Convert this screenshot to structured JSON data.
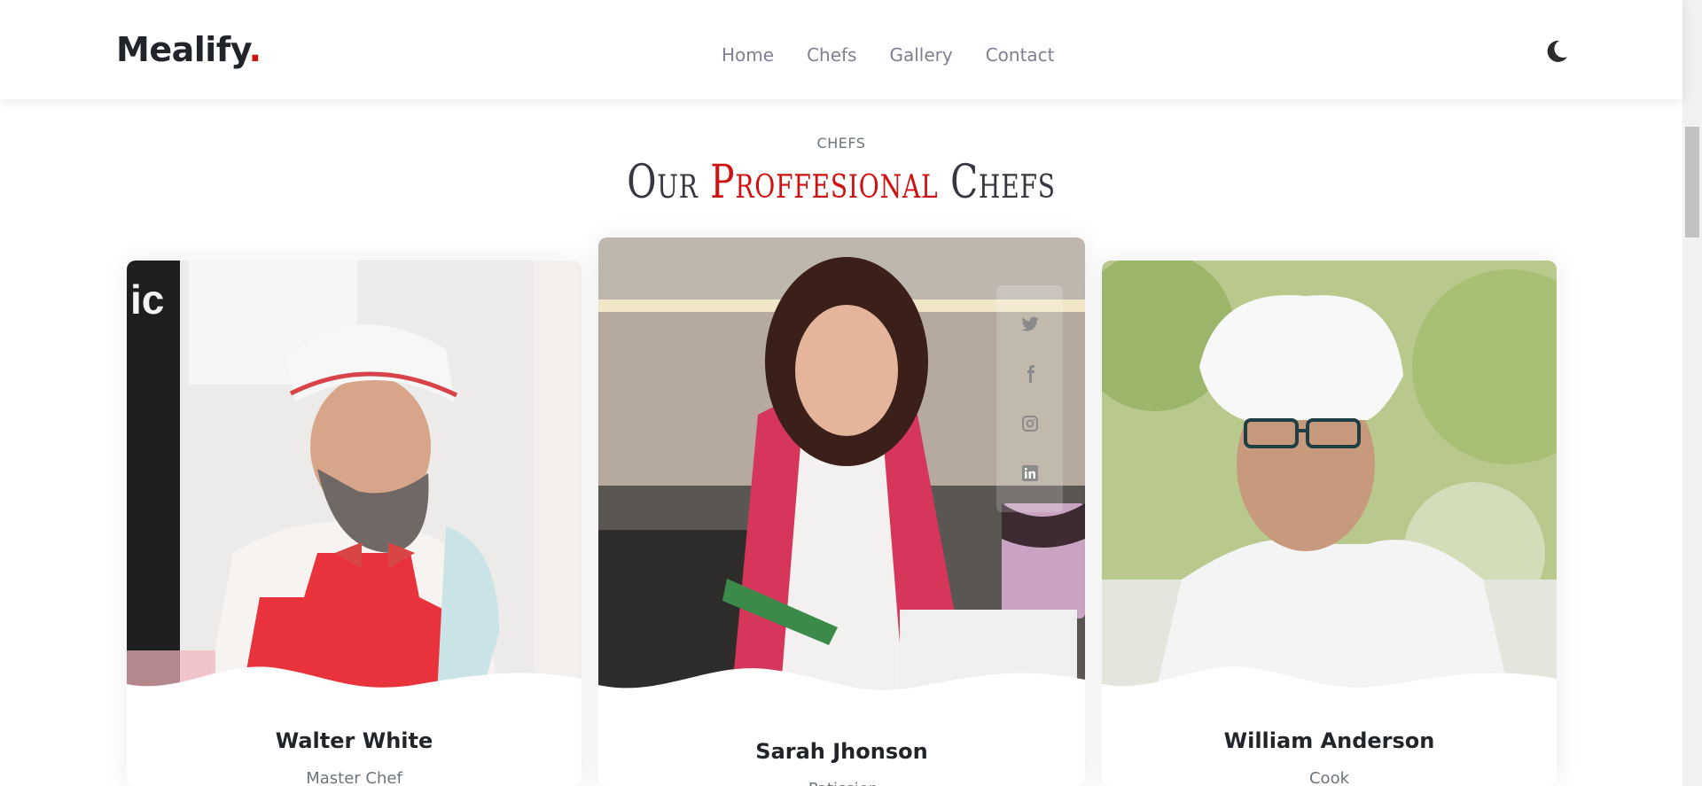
{
  "header": {
    "logo_text": "Mealify",
    "logo_dot": ".",
    "nav": [
      {
        "label": "Home"
      },
      {
        "label": "Chefs"
      },
      {
        "label": "Gallery"
      },
      {
        "label": "Contact"
      }
    ],
    "theme_toggle_icon": "moon-icon"
  },
  "section": {
    "eyebrow": "CHEFS",
    "title_start": "Our ",
    "title_accent": "Proffesional",
    "title_end": " Chefs"
  },
  "chefs": [
    {
      "name": "Walter White",
      "role": "Master Chef"
    },
    {
      "name": "Sarah Jhonson",
      "role": "Patissier",
      "social": [
        "twitter-icon",
        "facebook-icon",
        "instagram-icon",
        "linkedin-icon"
      ]
    },
    {
      "name": "William Anderson",
      "role": "Cook"
    }
  ],
  "colors": {
    "accent": "#ce1212",
    "nav_text": "#7f7f90",
    "heading": "#37373f"
  }
}
